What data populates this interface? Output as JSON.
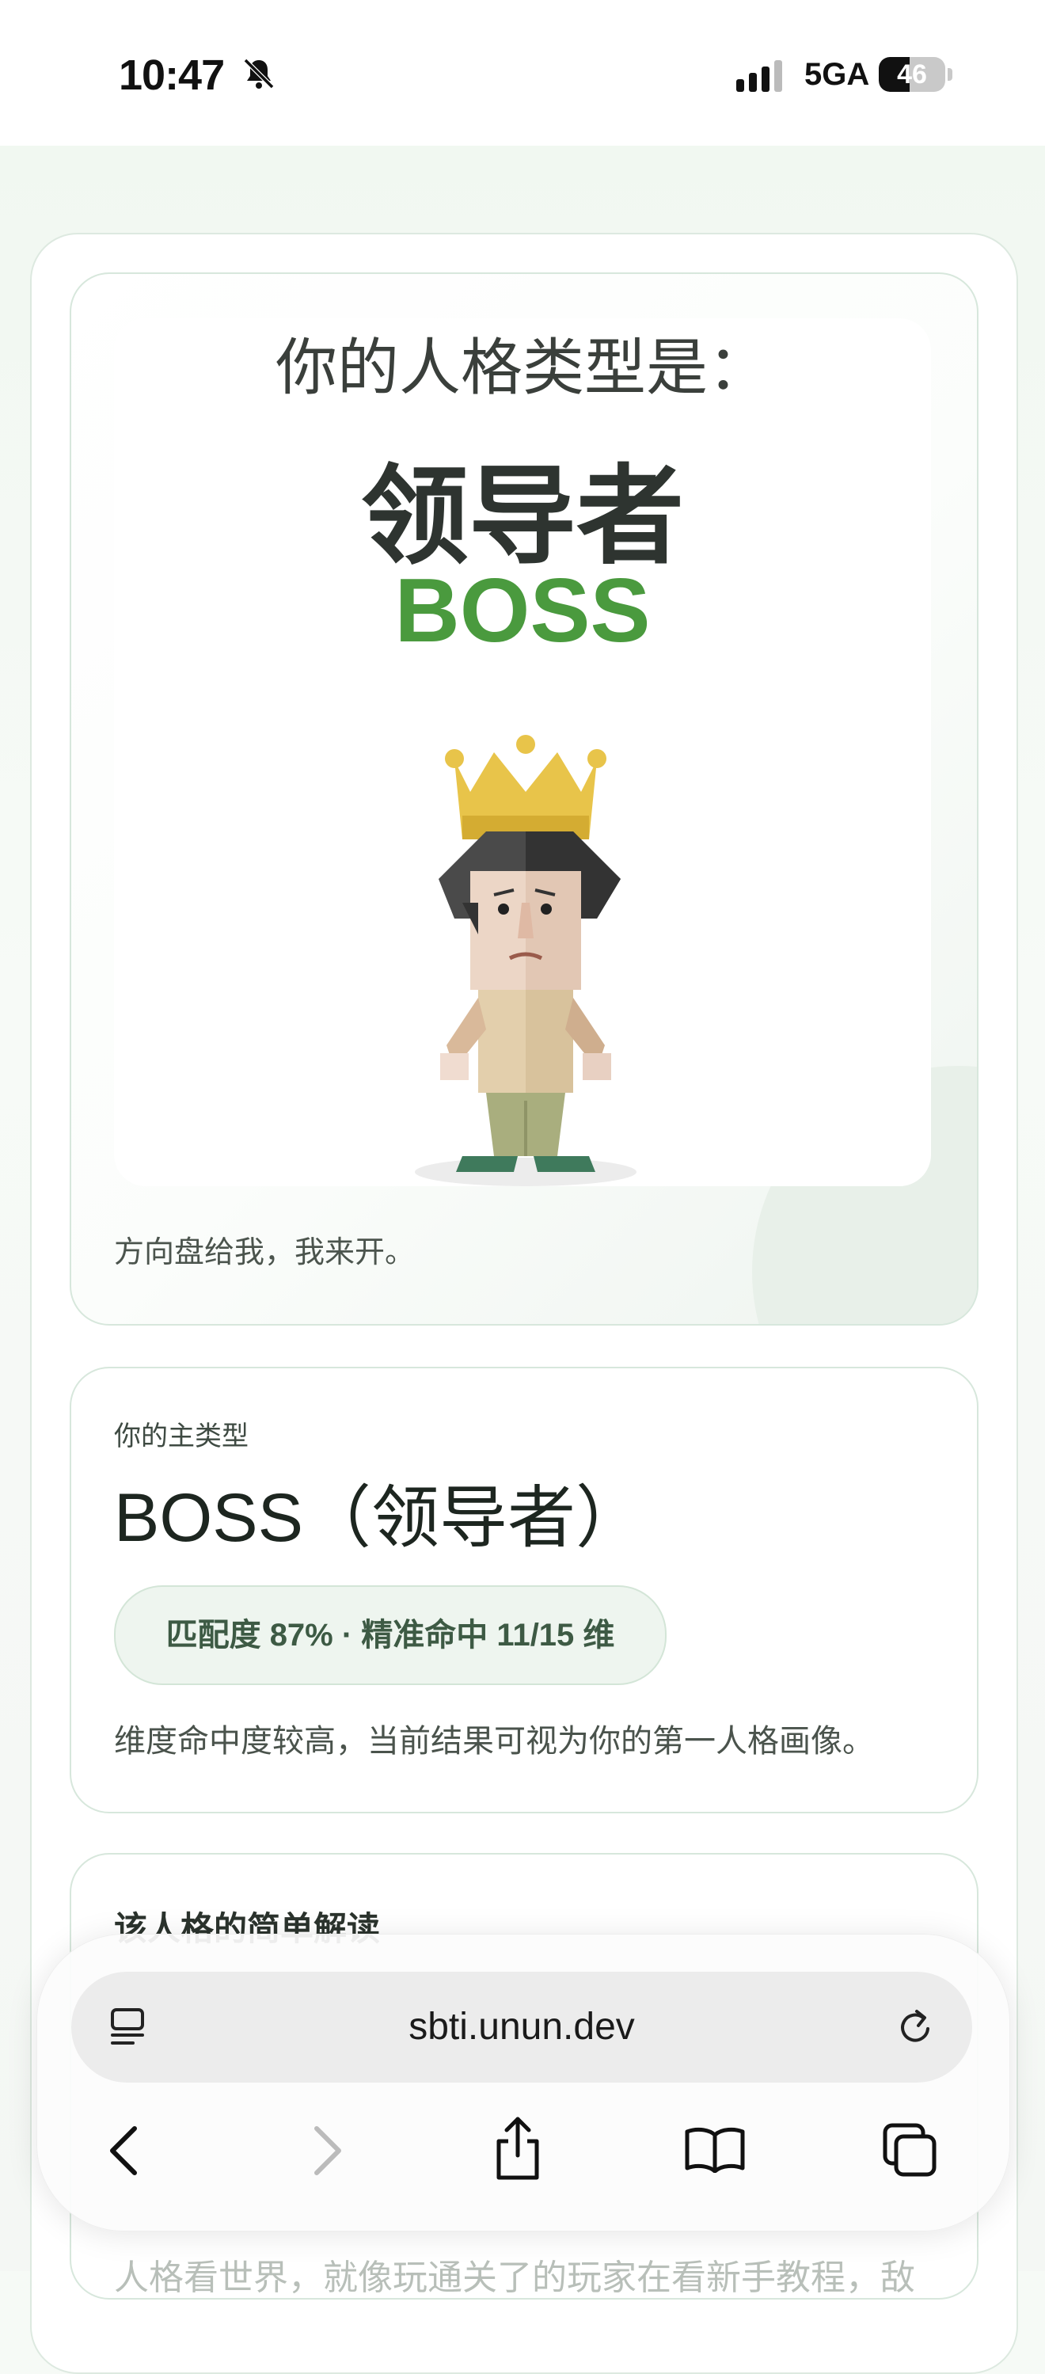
{
  "status_bar": {
    "time": "10:47",
    "network": "5GA",
    "battery": "46",
    "battery_level": 0.46
  },
  "hero": {
    "heading": "你的人格类型是：",
    "type_cn": "领导者",
    "type_en": "BOSS",
    "tagline": "方向盘给我，我来开。",
    "colors": {
      "accent": "#4a9a3e"
    }
  },
  "main_type": {
    "label": "你的主类型",
    "title": "BOSS（领导者）",
    "match": "匹配度 87% · 精准命中 11/15 维",
    "description": "维度命中度较高，当前结果可视为你的第一人格画像。"
  },
  "interpretation": {
    "title": "该人格的简单解读",
    "faded_line": "人格看世界，就像玩通关了的玩家在看新手教程，敌"
  },
  "browser": {
    "url": "sbti.unun.dev",
    "icons": [
      "tab-list-icon",
      "reload-icon",
      "back-icon",
      "forward-icon",
      "share-icon",
      "bookmarks-icon",
      "tabs-icon"
    ]
  }
}
